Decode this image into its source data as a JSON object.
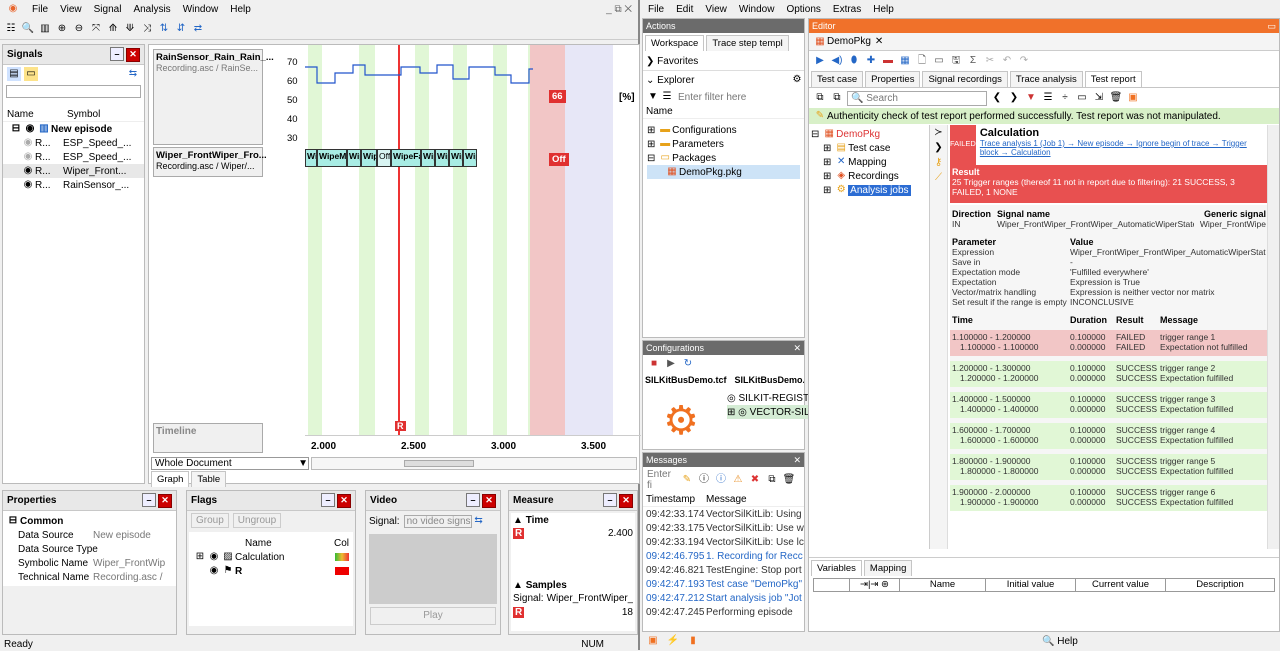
{
  "left_window": {
    "menu": [
      "File",
      "View",
      "Signal",
      "Analysis",
      "Window",
      "Help"
    ],
    "window_controls": "_ ⧉ ✕",
    "signals": {
      "title": "Signals",
      "col_name": "Name",
      "col_symbol": "Symbol",
      "episode": "New episode",
      "items": [
        {
          "name": "R...",
          "symbol": "ESP_Speed_..."
        },
        {
          "name": "R...",
          "symbol": "ESP_Speed_..."
        },
        {
          "name": "R...",
          "symbol": "Wiper_Front..."
        },
        {
          "name": "R...",
          "symbol": "RainSensor_..."
        }
      ]
    },
    "graph": {
      "sig1_title": "RainSensor_Rain_Rain_...",
      "sig1_sub": "Recording.asc / RainSe...",
      "sig2_title": "Wiper_FrontWiper_Fro...",
      "sig2_sub": "Recording.asc / Wiper/...",
      "y_ticks": [
        "70",
        "60",
        "50",
        "40",
        "30"
      ],
      "unit": "[%]",
      "value_66": "66",
      "value_off": "Off",
      "state_labels": [
        "Wi",
        "WipeMe",
        "Wip",
        "Wip",
        "Off",
        "WipeFas",
        "Wip",
        "Wip",
        "Wip",
        "Wip"
      ],
      "timeline": "Timeline",
      "cursor": "R",
      "x_ticks": [
        "2.000",
        "2.500",
        "3.000",
        "3.500"
      ],
      "scope": "Whole Document",
      "tab_graph": "Graph",
      "tab_table": "Table"
    },
    "properties": {
      "title": "Properties",
      "section": "Common",
      "rows": [
        {
          "k": "Data Source",
          "v": "New episode"
        },
        {
          "k": "Data Source Type",
          "v": ""
        },
        {
          "k": "Symbolic Name",
          "v": "Wiper_FrontWip"
        },
        {
          "k": "Technical Name",
          "v": "Recording.asc /"
        }
      ]
    },
    "flags": {
      "title": "Flags",
      "group": "Group",
      "ungroup": "Ungroup",
      "col_name": "Name",
      "col_col": "Col",
      "rows": [
        "Calculation",
        "R"
      ]
    },
    "video": {
      "title": "Video",
      "signal_label": "Signal:",
      "signal_value": "no video signs",
      "play": "Play"
    },
    "measure": {
      "title": "Measure",
      "time": "Time",
      "time_value": "2.400",
      "cursor": "R",
      "samples": "Samples",
      "signal": "Signal:",
      "signal_value": "Wiper_FrontWiper_...",
      "samples_value": "18"
    },
    "status": {
      "left": "Ready",
      "num": "NUM"
    }
  },
  "right_window": {
    "menu": [
      "File",
      "Edit",
      "View",
      "Window",
      "Options",
      "Extras",
      "Help"
    ],
    "actions": {
      "title": "Actions",
      "tab_workspace": "Workspace",
      "tab_trace": "Trace step templ",
      "favorites": "Favorites",
      "explorer": "Explorer",
      "filter_placeholder": "Enter filter here",
      "col_name": "Name",
      "tree": [
        "Configurations",
        "Parameters",
        "Packages",
        "DemoPkg.pkg"
      ]
    },
    "configurations": {
      "title": "Configurations",
      "file1": "SILKitBusDemo.tcf",
      "file2": "SILKitBusDemo.tbc",
      "item1": "SILKIT-REGIST",
      "item2": "VECTOR-SIL-"
    },
    "messages": {
      "title": "Messages",
      "filter_placeholder": "Enter fi",
      "col_ts": "Timestamp",
      "col_msg": "Message",
      "rows": [
        {
          "t": "09:42:33.174",
          "m": "VectorSilKitLib: Using",
          "blue": false
        },
        {
          "t": "09:42:33.175",
          "m": "VectorSilKitLib: Use w",
          "blue": false
        },
        {
          "t": "09:42:33.194",
          "m": "VectorSilKitLib: Use lc",
          "blue": false
        },
        {
          "t": "09:42:46.795",
          "m": "1. Recording for Recc",
          "blue": true
        },
        {
          "t": "09:42:46.821",
          "m": "TestEngine: Stop port",
          "blue": false
        },
        {
          "t": "09:42:47.193",
          "m": "Test case \"DemoPkg\"",
          "blue": true
        },
        {
          "t": "09:42:47.212",
          "m": "Start analysis job \"Jot",
          "blue": true
        },
        {
          "t": "09:42:47.245",
          "m": "Performing episode",
          "blue": false
        }
      ]
    },
    "editor": {
      "title": "Editor",
      "doc_tab": "DemoPkg",
      "tabs": [
        "Test case",
        "Properties",
        "Signal recordings",
        "Trace analysis",
        "Test report"
      ],
      "search": "Search",
      "banner": "Authenticity check of test report performed successfully. Test report was not manipulated.",
      "tree": [
        "DemoPkg",
        "Test case",
        "Mapping",
        "Recordings",
        "Analysis jobs"
      ],
      "report": {
        "heading": "Calculation",
        "failed": "FAILED",
        "path": "Trace analysis 1 (Job 1) → New episode → Ignore begin of trace → Trigger block → Calculation",
        "result_label": "Result",
        "result_text": "25 Trigger ranges (thereof 11 not in report due to filtering): 21 SUCCESS, 3 FAILED, 1 NONE",
        "dir_head": "Direction",
        "sig_head": "Signal name",
        "gen_head": "Generic signal",
        "dir": "IN",
        "sig": "Wiper_FrontWiper_FrontWiper_AutomaticWiperState",
        "gen": "Wiper_FrontWipe",
        "param_head": "Parameter",
        "value_head": "Value",
        "params": [
          {
            "k": "Expression",
            "v": "Wiper_FrontWiper_FrontWiper_AutomaticWiperStat"
          },
          {
            "k": "Save in",
            "v": "-"
          },
          {
            "k": "Expectation mode",
            "v": "'Fulfilled everywhere'"
          },
          {
            "k": "Expectation",
            "v": "Expression is True"
          },
          {
            "k": "Vector/matrix handling",
            "v": "Expression is neither vector nor matrix"
          },
          {
            "k": "Set result if the range is empty",
            "v": "INCONCLUSIVE"
          }
        ],
        "cols": [
          "Time",
          "Duration",
          "Result",
          "Message"
        ],
        "groups": [
          {
            "fail": true,
            "a": [
              "1.100000 - 1.200000",
              "0.100000",
              "FAILED",
              "trigger range 1"
            ],
            "b": [
              "1.100000 - 1.100000",
              "0.000000",
              "FAILED",
              "Expectation not fulfilled"
            ]
          },
          {
            "fail": false,
            "a": [
              "1.200000 - 1.300000",
              "0.100000",
              "SUCCESS",
              "trigger range 2"
            ],
            "b": [
              "1.200000 - 1.200000",
              "0.000000",
              "SUCCESS",
              "Expectation fulfilled"
            ]
          },
          {
            "fail": false,
            "a": [
              "1.400000 - 1.500000",
              "0.100000",
              "SUCCESS",
              "trigger range 3"
            ],
            "b": [
              "1.400000 - 1.400000",
              "0.000000",
              "SUCCESS",
              "Expectation fulfilled"
            ]
          },
          {
            "fail": false,
            "a": [
              "1.600000 - 1.700000",
              "0.100000",
              "SUCCESS",
              "trigger range 4"
            ],
            "b": [
              "1.600000 - 1.600000",
              "0.000000",
              "SUCCESS",
              "Expectation fulfilled"
            ]
          },
          {
            "fail": false,
            "a": [
              "1.800000 - 1.900000",
              "0.100000",
              "SUCCESS",
              "trigger range 5"
            ],
            "b": [
              "1.800000 - 1.800000",
              "0.000000",
              "SUCCESS",
              "Expectation fulfilled"
            ]
          },
          {
            "fail": false,
            "a": [
              "1.900000 - 2.000000",
              "0.100000",
              "SUCCESS",
              "trigger range 6"
            ],
            "b": [
              "1.900000 - 1.900000",
              "0.000000",
              "SUCCESS",
              "Expectation fulfilled"
            ]
          }
        ]
      },
      "vars_tab": "Variables",
      "mapping_tab": "Mapping",
      "var_cols": [
        "Name",
        "Initial value",
        "Current value",
        "Description"
      ],
      "help": "Help"
    }
  }
}
